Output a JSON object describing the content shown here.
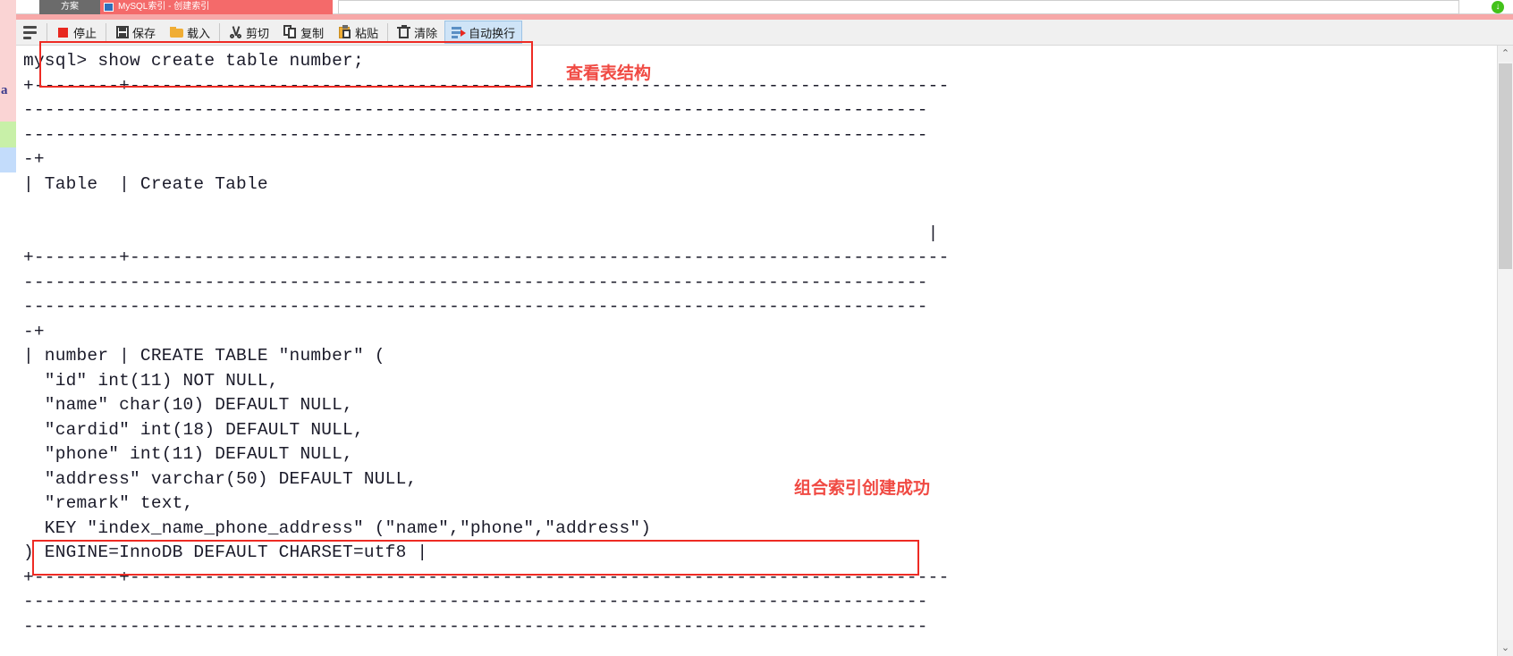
{
  "window": {
    "chrome_tab_dark_label": "方案",
    "chrome_tab_red_label": "MySQL索引 - 创建索引",
    "chrome_badge": "↓"
  },
  "toolbar": {
    "menu_label": "",
    "items": [
      {
        "id": "stop",
        "label": "停止",
        "icon": "stop-icon",
        "active": false
      },
      {
        "id": "save",
        "label": "保存",
        "icon": "save-icon",
        "active": false
      },
      {
        "id": "load",
        "label": "载入",
        "icon": "folder-icon",
        "active": false
      },
      {
        "id": "cut",
        "label": "剪切",
        "icon": "scissors-icon",
        "active": false
      },
      {
        "id": "copy",
        "label": "复制",
        "icon": "copy-icon",
        "active": false
      },
      {
        "id": "paste",
        "label": "粘贴",
        "icon": "clipboard-icon",
        "active": false
      },
      {
        "id": "clear",
        "label": "清除",
        "icon": "trash-icon",
        "active": false
      },
      {
        "id": "wrap",
        "label": "自动换行",
        "icon": "word-wrap-icon",
        "active": true
      }
    ]
  },
  "terminal": {
    "lines": [
      "mysql> show create table number;",
      "+--------+-----------------------------------------------------------------------------",
      "-------------------------------------------------------------------------------------",
      "-------------------------------------------------------------------------------------",
      "-+",
      "| Table  | Create Table",
      "",
      "                                                                                     |",
      "+--------+-----------------------------------------------------------------------------",
      "-------------------------------------------------------------------------------------",
      "-------------------------------------------------------------------------------------",
      "-+",
      "| number | CREATE TABLE \"number\" (",
      "  \"id\" int(11) NOT NULL,",
      "  \"name\" char(10) DEFAULT NULL,",
      "  \"cardid\" int(18) DEFAULT NULL,",
      "  \"phone\" int(11) DEFAULT NULL,",
      "  \"address\" varchar(50) DEFAULT NULL,",
      "  \"remark\" text,",
      "  KEY \"index_name_phone_address\" (\"name\",\"phone\",\"address\")",
      ") ENGINE=InnoDB DEFAULT CHARSET=utf8 |",
      "+--------+-----------------------------------------------------------------------------",
      "-------------------------------------------------------------------------------------",
      "-------------------------------------------------------------------------------------"
    ]
  },
  "annotations": {
    "view_table_structure": "查看表结构",
    "index_created_success": "组合索引创建成功",
    "color": "#f04a43"
  },
  "sidebar_strip": {
    "letter": "a"
  },
  "scrollbar": {
    "up_arrow": "⌃",
    "down_arrow": "⌄"
  }
}
